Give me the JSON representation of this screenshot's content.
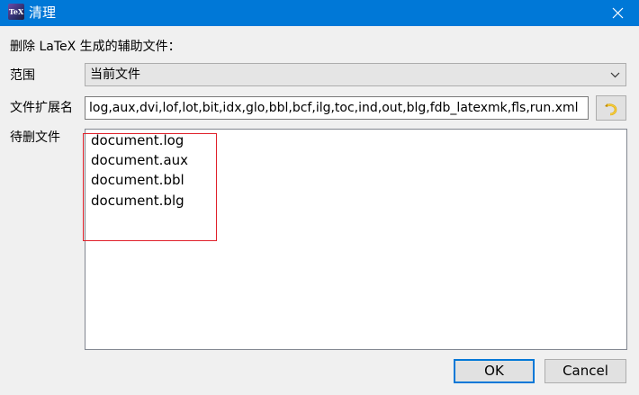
{
  "window": {
    "title": "清理",
    "icon_text": "TeX"
  },
  "description": "删除 LaTeX 生成的辅助文件：",
  "scope": {
    "label": "范围",
    "value": "当前文件"
  },
  "extensions": {
    "label": "文件扩展名",
    "value": "log,aux,dvi,lof,lot,bit,idx,glo,bbl,bcf,ilg,toc,ind,out,blg,fdb_latexmk,fls,run.xml"
  },
  "files": {
    "label": "待删文件",
    "items": [
      "document.log",
      "document.aux",
      "document.bbl",
      "document.blg"
    ]
  },
  "buttons": {
    "ok": "OK",
    "cancel": "Cancel"
  },
  "colors": {
    "titlebar": "#0078d7",
    "highlight": "#e0202a",
    "background": "#f0f0f0"
  }
}
